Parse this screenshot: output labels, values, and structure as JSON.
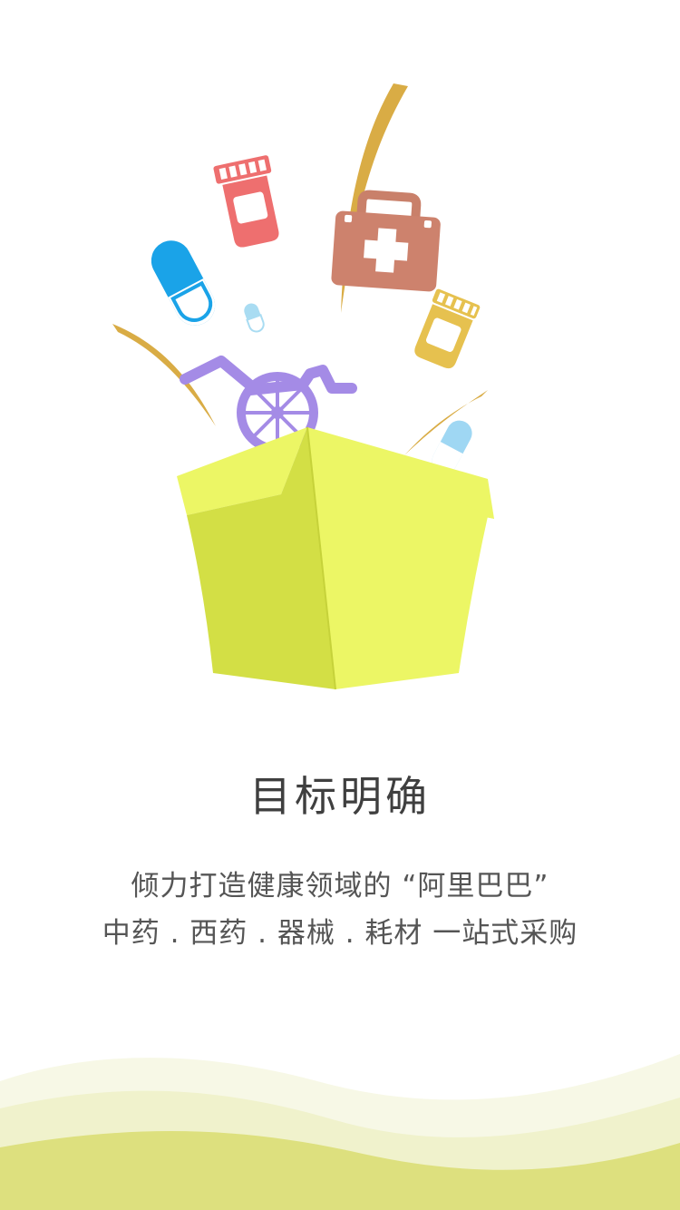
{
  "intro": {
    "title": "目标明确",
    "description_line1": "倾力打造健康领域的 “阿里巴巴”",
    "description_line2": "中药 . 西药 . 器械 . 耗材 一站式采购"
  },
  "illustration": {
    "items": [
      "box-icon",
      "first-aid-kit-icon",
      "medicine-bottle-icon",
      "capsule-icon",
      "wheelchair-icon"
    ]
  },
  "colors": {
    "box_front": "#ecf665",
    "box_side": "#d3df45",
    "wave_light": "#f7f8e6",
    "wave_mid": "#f0f2cc",
    "wave_dark": "#dde07e"
  }
}
